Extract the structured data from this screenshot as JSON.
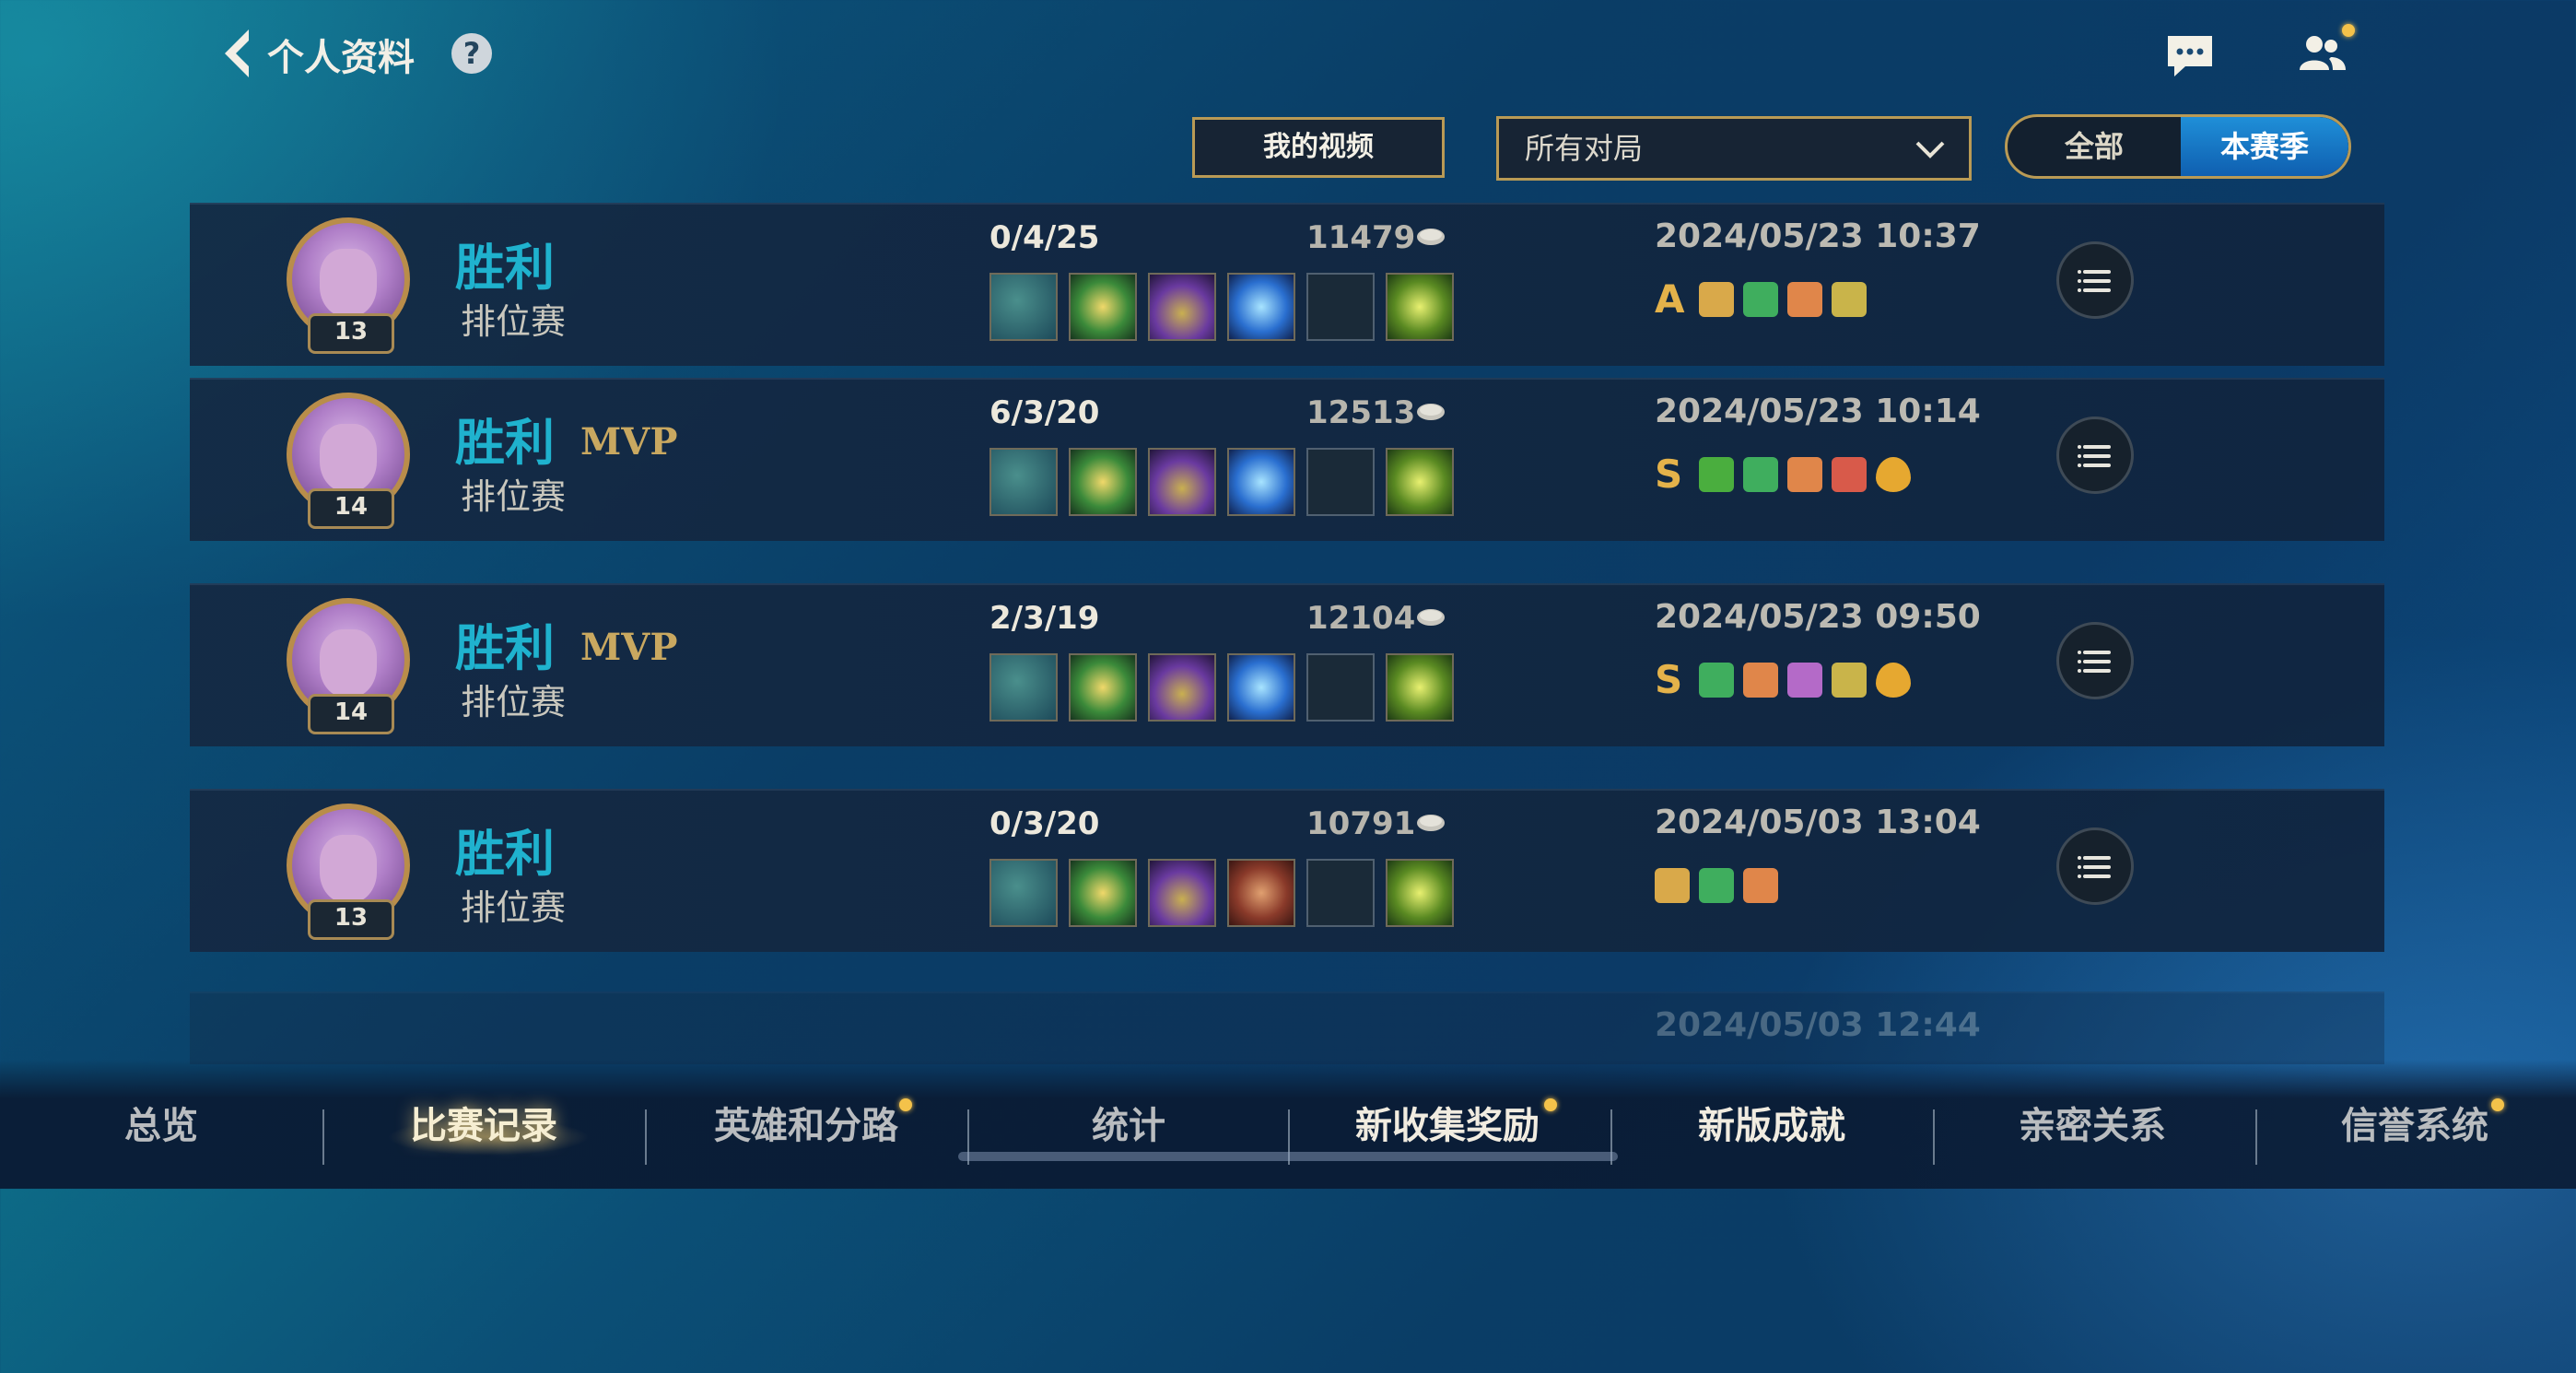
{
  "header": {
    "title": "个人资料",
    "help": "?"
  },
  "filters": {
    "my_video": "我的视频",
    "match_filter": "所有对局",
    "segment": [
      "全部",
      "本赛季"
    ],
    "segment_selected": "本赛季"
  },
  "matches": [
    {
      "result": "胜利",
      "mvp": "",
      "mode": "排位赛",
      "level": "13",
      "kda": "0/4/25",
      "gold": "11479",
      "time": "2024/05/23 10:37",
      "grade": "A"
    },
    {
      "result": "胜利",
      "mvp": "MVP",
      "mode": "排位赛",
      "level": "14",
      "kda": "6/3/20",
      "gold": "12513",
      "time": "2024/05/23 10:14",
      "grade": "S"
    },
    {
      "result": "胜利",
      "mvp": "MVP",
      "mode": "排位赛",
      "level": "14",
      "kda": "2/3/19",
      "gold": "12104",
      "time": "2024/05/23 09:50",
      "grade": "S"
    },
    {
      "result": "胜利",
      "mvp": "",
      "mode": "排位赛",
      "level": "13",
      "kda": "0/3/20",
      "gold": "10791",
      "time": "2024/05/03 13:04",
      "grade": ""
    },
    {
      "time": "2024/05/03 12:44"
    }
  ],
  "nav": {
    "tabs": [
      "总览",
      "比赛记录",
      "英雄和分路",
      "统计",
      "新收集奖励",
      "新版成就",
      "亲密关系",
      "信誉系统"
    ],
    "active": "比赛记录"
  },
  "colors": {
    "accent_gold": "#b99a55",
    "victory": "#1fb2ce",
    "notification": "#f4c24a"
  }
}
